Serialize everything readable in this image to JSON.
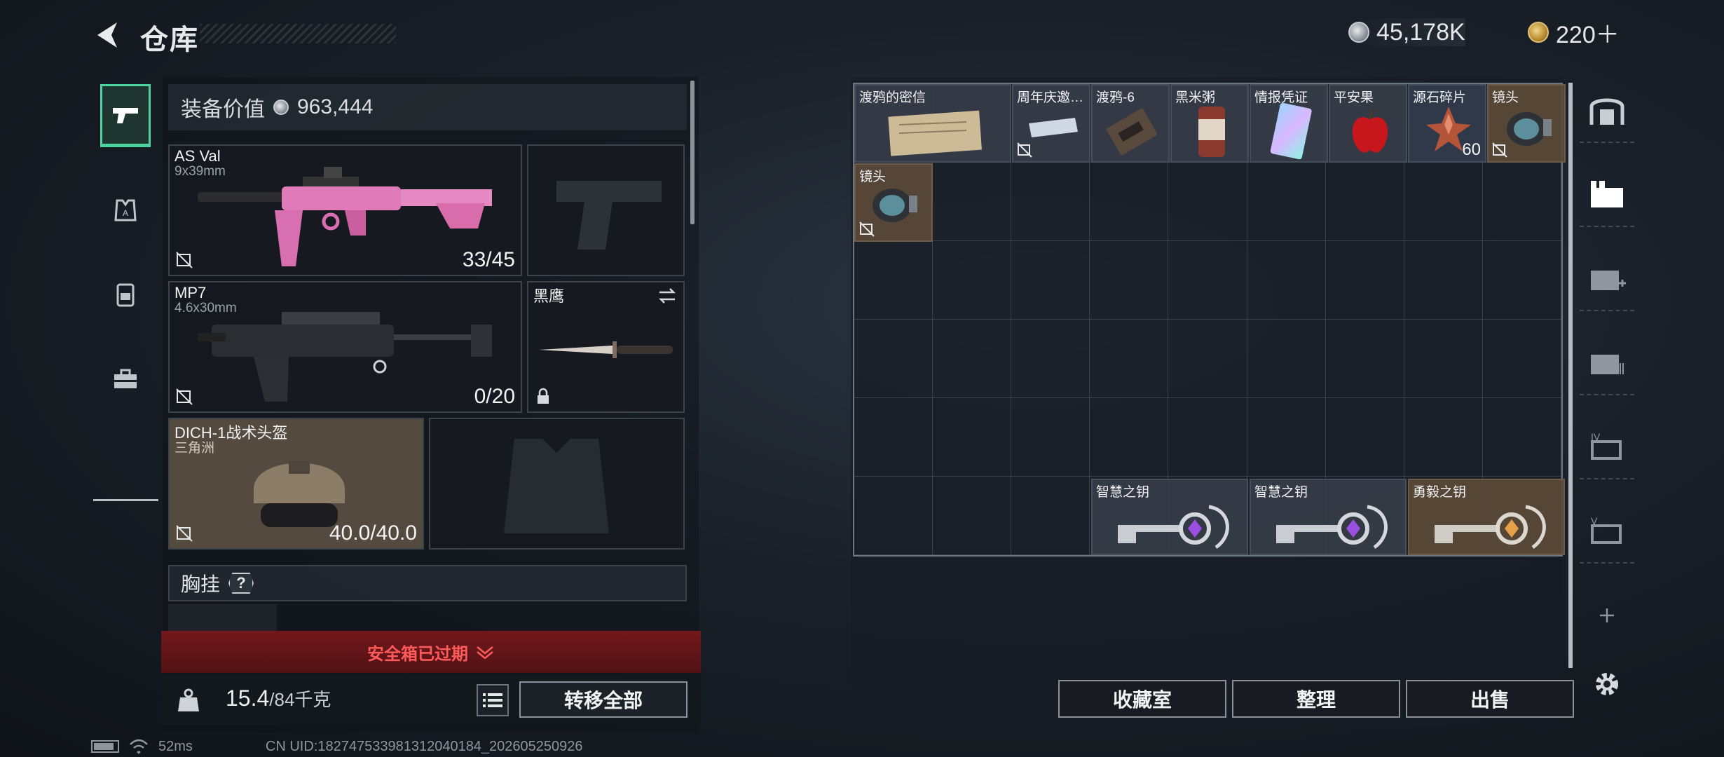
{
  "header": {
    "title": "仓库"
  },
  "currency": {
    "coins": "45,178K",
    "tokens": "220＋"
  },
  "equipment": {
    "value_label": "装备价值",
    "value": "963,444",
    "primary_weapon": {
      "name": "AS Val",
      "ammo": "9x39mm",
      "count": "33/45"
    },
    "sidearm": {
      "name": ""
    },
    "secondary_weapon": {
      "name": "MP7",
      "ammo": "4.6x30mm",
      "count": "0/20"
    },
    "melee": {
      "name": "黑鹰"
    },
    "helmet": {
      "name": "DICH-1战术头盔",
      "sub": "三角洲",
      "durability": "40.0/40.0"
    },
    "chest_rig_label": "胸挂",
    "help_label": "?",
    "safe_box_status": "安全箱已过期",
    "weight_current": "15.4",
    "weight_max": "/84千克",
    "transfer_all": "转移全部"
  },
  "storage": {
    "items": [
      {
        "name": "渡鸦的密信",
        "qty": ""
      },
      {
        "name": "周年庆邀…",
        "qty": ""
      },
      {
        "name": "渡鸦-6",
        "qty": ""
      },
      {
        "name": "黑米粥",
        "qty": ""
      },
      {
        "name": "情报凭证",
        "qty": ""
      },
      {
        "name": "平安果",
        "qty": ""
      },
      {
        "name": "源石碎片",
        "qty": "60"
      },
      {
        "name": "镜头",
        "qty": ""
      },
      {
        "name": "镜头",
        "qty": ""
      },
      {
        "name": "智慧之钥",
        "qty": ""
      },
      {
        "name": "智慧之钥",
        "qty": ""
      },
      {
        "name": "勇毅之钥",
        "qty": ""
      }
    ],
    "buttons": {
      "collection": "收藏室",
      "organize": "整理",
      "sell": "出售"
    }
  },
  "right_filters": [
    "building-icon",
    "weapon-case-icon",
    "medkit-case-icon",
    "storage-case-icon",
    "case-iv-icon",
    "case-v-icon"
  ],
  "status": {
    "ping": "52ms",
    "uid": "CN UID:18274753398131204018​4_202605250926"
  },
  "colors": {
    "accent_green": "#4fd3a0",
    "warning_red": "#ff5b5b",
    "gold_item_bg": "#5c4a38"
  }
}
